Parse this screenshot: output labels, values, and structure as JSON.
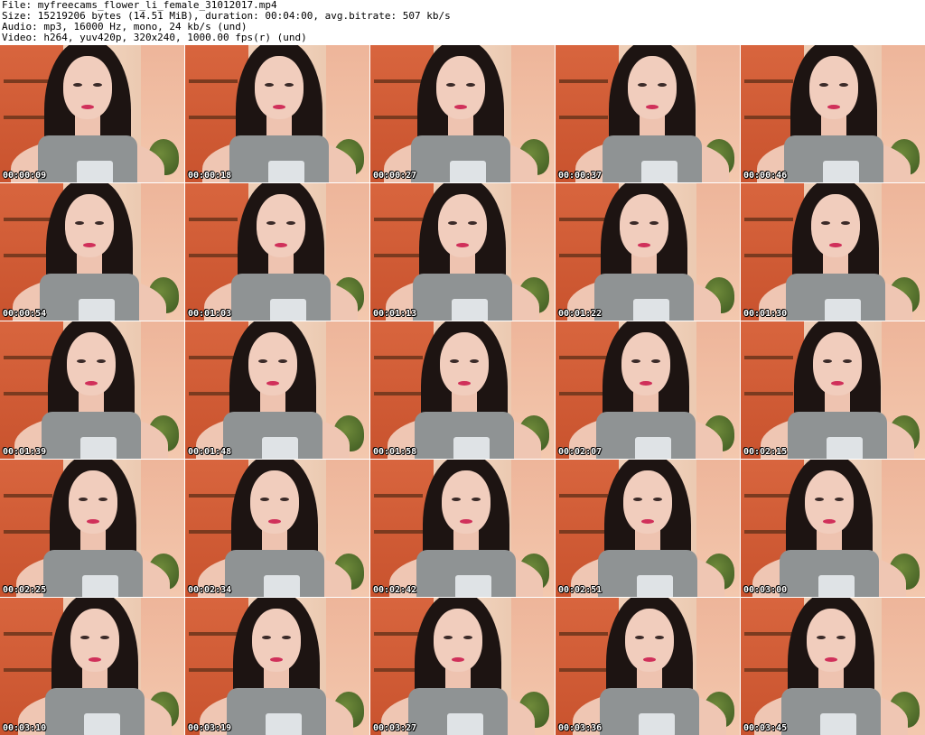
{
  "header": {
    "file": "File: myfreecams_flower_li_female_31012017.mp4",
    "size": "Size: 15219206 bytes (14.51 MiB), duration: 00:04:00, avg.bitrate: 507 kb/s",
    "audio": "Audio: mp3, 16000 Hz, mono, 24 kb/s (und)",
    "video": "Video: h264, yuv420p, 320x240, 1000.00 fps(r) (und)"
  },
  "thumbnails": [
    {
      "timestamp": "00:00:09"
    },
    {
      "timestamp": "00:00:18"
    },
    {
      "timestamp": "00:00:27"
    },
    {
      "timestamp": "00:00:37"
    },
    {
      "timestamp": "00:00:46"
    },
    {
      "timestamp": "00:00:54"
    },
    {
      "timestamp": "00:01:03"
    },
    {
      "timestamp": "00:01:13"
    },
    {
      "timestamp": "00:01:22"
    },
    {
      "timestamp": "00:01:30"
    },
    {
      "timestamp": "00:01:39"
    },
    {
      "timestamp": "00:01:48"
    },
    {
      "timestamp": "00:01:58"
    },
    {
      "timestamp": "00:02:07"
    },
    {
      "timestamp": "00:02:15"
    },
    {
      "timestamp": "00:02:25"
    },
    {
      "timestamp": "00:02:34"
    },
    {
      "timestamp": "00:02:42"
    },
    {
      "timestamp": "00:02:51"
    },
    {
      "timestamp": "00:03:00"
    },
    {
      "timestamp": "00:03:10"
    },
    {
      "timestamp": "00:03:19"
    },
    {
      "timestamp": "00:03:27"
    },
    {
      "timestamp": "00:03:36"
    },
    {
      "timestamp": "00:03:45"
    }
  ]
}
